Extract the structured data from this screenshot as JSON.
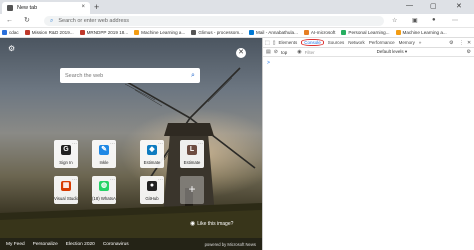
{
  "browser": {
    "tab_title": "New tab",
    "tab_close": "×",
    "new_tab": "+",
    "win_min": "—",
    "win_max": "▢",
    "win_close": "✕"
  },
  "addressbar": {
    "back": "←",
    "refresh": "↻",
    "placeholder": "Search or enter web address"
  },
  "bookmarks": [
    {
      "label": "cdac",
      "color": "#2a6fdb"
    },
    {
      "label": "Mission R&D 2019...",
      "color": "#c0392b"
    },
    {
      "label": "MRNDPP 2019 18...",
      "color": "#c0392b"
    },
    {
      "label": "Machine Learning a...",
      "color": "#f39c12"
    },
    {
      "label": "Glimus - processom...",
      "color": "#555555"
    },
    {
      "label": "Mail - Annabathula...",
      "color": "#0078d4"
    },
    {
      "label": "AI-microsoft",
      "color": "#e67e22"
    },
    {
      "label": "Personal Learning...",
      "color": "#27ae60"
    },
    {
      "label": "Machine Learning a...",
      "color": "#f39c12"
    }
  ],
  "ntp": {
    "search_placeholder": "Search the web",
    "search_icon": "search-icon",
    "tiles_row1": [
      {
        "label": "Sign In",
        "glyph": "G",
        "color": "#222222"
      },
      {
        "label": "Inkle",
        "glyph": "✎",
        "color": "#1e88e5"
      },
      {
        "label": "Estimate",
        "glyph": "◆",
        "color": "#0f7cc0"
      },
      {
        "label": "Estimate",
        "glyph": "L",
        "color": "#6d4c41"
      }
    ],
    "tiles_row2": [
      {
        "label": "Visual Studio ...",
        "glyph": "▦",
        "color": "#d83b01"
      },
      {
        "label": "(18) WhatsApp",
        "glyph": "◍",
        "color": "#25d366"
      },
      {
        "label": "GitHub",
        "glyph": "●",
        "color": "#222222"
      }
    ],
    "like_image": "Like this image?",
    "bottom_nav": [
      "My Feed",
      "Personalize",
      "Election 2020",
      "Coronavirus"
    ],
    "powered_by": "powered by Microsoft News"
  },
  "devtools": {
    "tabs": [
      "Elements",
      "Console",
      "Sources",
      "Network",
      "Performance",
      "Memory",
      "»"
    ],
    "active_tab": "Console",
    "context": "top",
    "filter_placeholder": "Filter",
    "levels": "Default levels ▾",
    "prompt": ">"
  }
}
